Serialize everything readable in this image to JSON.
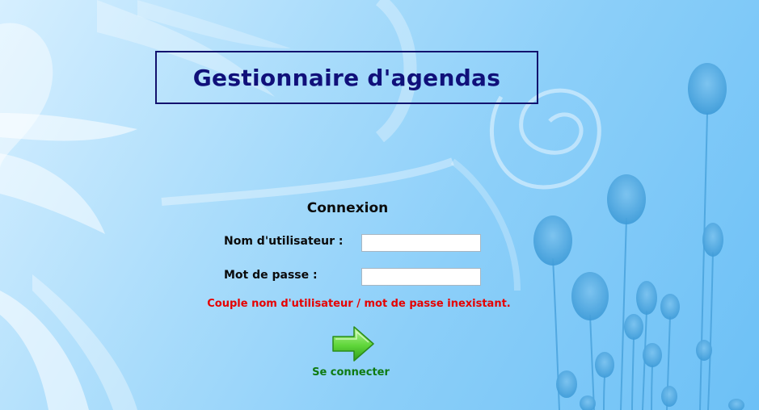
{
  "page": {
    "title": "Gestionnaire d'agendas"
  },
  "login": {
    "heading": "Connexion",
    "username_label": "Nom d'utilisateur :",
    "username_value": "",
    "password_label": "Mot de passe :",
    "password_value": "",
    "error_message": "Couple nom d'utilisateur / mot de passe inexistant.",
    "submit_label": "Se connecter",
    "submit_icon": "arrow-right-icon"
  },
  "colors": {
    "title_text": "#10107a",
    "title_border": "#12126e",
    "error_text": "#e60000",
    "submit_text": "#0e7a12",
    "arrow_fill": "#5fd63a",
    "background_light": "#d6efff",
    "background_dark": "#6cc0f6"
  }
}
